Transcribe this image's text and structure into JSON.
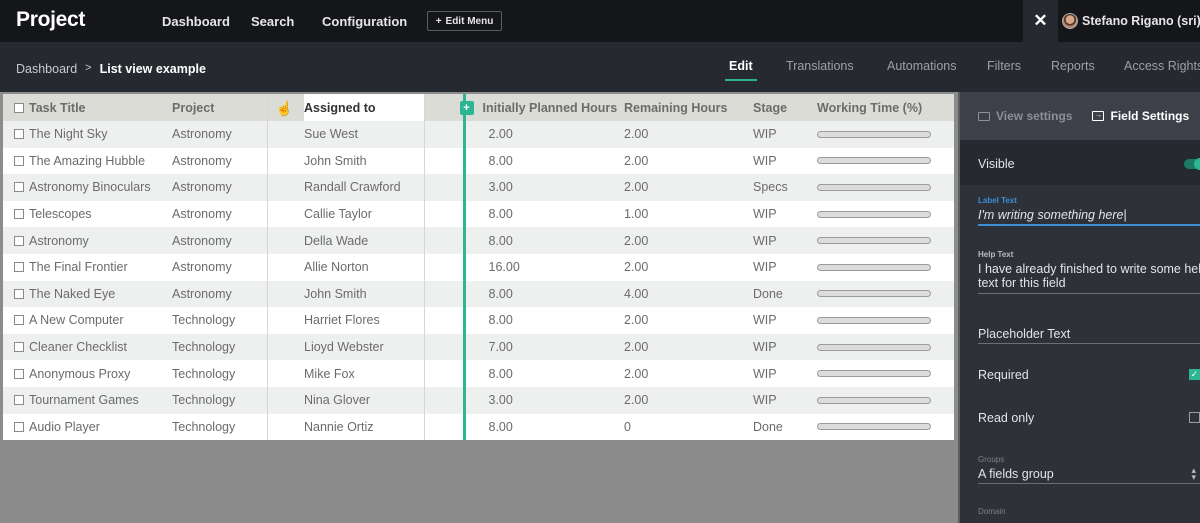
{
  "topbar": {
    "brand": "Project",
    "nav": [
      "Dashboard",
      "Search",
      "Configuration"
    ],
    "edit_menu_label": "Edit Menu",
    "edit_menu_icon": "+",
    "tools_icon": "✕",
    "user_name": "Stefano Rigano (sri)"
  },
  "breadcrumb": {
    "parent": "Dashboard",
    "separator": ">",
    "current": "List view example"
  },
  "tabs": [
    {
      "label": "Edit",
      "active": true
    },
    {
      "label": "Translations",
      "active": false
    },
    {
      "label": "Automations",
      "active": false
    },
    {
      "label": "Filters",
      "active": false
    },
    {
      "label": "Reports",
      "active": false
    },
    {
      "label": "Access Rights",
      "active": false
    }
  ],
  "table": {
    "columns": [
      "Task Title",
      "Project",
      "Assigned to",
      "Initially Planned Hours",
      "Remaining Hours",
      "Stage",
      "Working Time  (%)"
    ],
    "add_column_icon": "+",
    "rows": [
      {
        "title": "The Night Sky",
        "project": "Astronomy",
        "assigned": "Sue West",
        "planned": "2.00",
        "remaining": "2.00",
        "stage": "WIP",
        "working_time": 0
      },
      {
        "title": "The Amazing Hubble",
        "project": "Astronomy",
        "assigned": "John Smith",
        "planned": "8.00",
        "remaining": "2.00",
        "stage": "WIP",
        "working_time": 0
      },
      {
        "title": "Astronomy Binoculars",
        "project": "Astronomy",
        "assigned": "Randall Crawford",
        "planned": "3.00",
        "remaining": "2.00",
        "stage": "Specs",
        "working_time": 0
      },
      {
        "title": "Telescopes",
        "project": "Astronomy",
        "assigned": "Callie Taylor",
        "planned": "8.00",
        "remaining": "1.00",
        "stage": "WIP",
        "working_time": 0
      },
      {
        "title": "Astronomy",
        "project": "Astronomy",
        "assigned": "Della Wade",
        "planned": "8.00",
        "remaining": "2.00",
        "stage": "WIP",
        "working_time": 0
      },
      {
        "title": "The Final Frontier",
        "project": "Astronomy",
        "assigned": "Allie Norton",
        "planned": "16.00",
        "remaining": "2.00",
        "stage": "WIP",
        "working_time": 0
      },
      {
        "title": "The Naked Eye",
        "project": "Astronomy",
        "assigned": "John Smith",
        "planned": "8.00",
        "remaining": "4.00",
        "stage": "Done",
        "working_time": 0
      },
      {
        "title": "A New Computer",
        "project": "Technology",
        "assigned": "Harriet Flores",
        "planned": "8.00",
        "remaining": "2.00",
        "stage": "WIP",
        "working_time": 0
      },
      {
        "title": "Cleaner Checklist",
        "project": "Technology",
        "assigned": "Lioyd Webster",
        "planned": "7.00",
        "remaining": "2.00",
        "stage": "WIP",
        "working_time": 0
      },
      {
        "title": "Anonymous Proxy",
        "project": "Technology",
        "assigned": "Mike Fox",
        "planned": "8.00",
        "remaining": "2.00",
        "stage": "WIP",
        "working_time": 0
      },
      {
        "title": "Tournament Games",
        "project": "Technology",
        "assigned": "Nina Glover",
        "planned": "3.00",
        "remaining": "2.00",
        "stage": "WIP",
        "working_time": 0
      },
      {
        "title": "Audio Player",
        "project": "Technology",
        "assigned": "Nannie Ortiz",
        "planned": "8.00",
        "remaining": "0",
        "stage": "Done",
        "working_time": 0
      }
    ]
  },
  "panel": {
    "tabs": [
      {
        "label": "View settings",
        "icon": "monitor-icon",
        "active": false
      },
      {
        "label": "Field Settings",
        "icon": "field-icon",
        "active": true
      }
    ],
    "visible_label": "Visible",
    "visible_on": true,
    "label_text": {
      "label": "Label Text",
      "value": "I'm writing something here"
    },
    "help_text": {
      "label": "Help Text",
      "value": "I have already finished to write some help text for this field"
    },
    "placeholder_text": {
      "placeholder": "Placeholder Text"
    },
    "required": {
      "label": "Required",
      "checked": true
    },
    "read_only": {
      "label": "Read only",
      "checked": false
    },
    "groups": {
      "label": "Groups",
      "value": "A fields group"
    },
    "domain": {
      "label": "Domain"
    }
  },
  "colors": {
    "accent": "#2db693",
    "focus": "#3b8fd6",
    "topbar_bg": "#14161a",
    "subbar_bg": "#262930"
  }
}
